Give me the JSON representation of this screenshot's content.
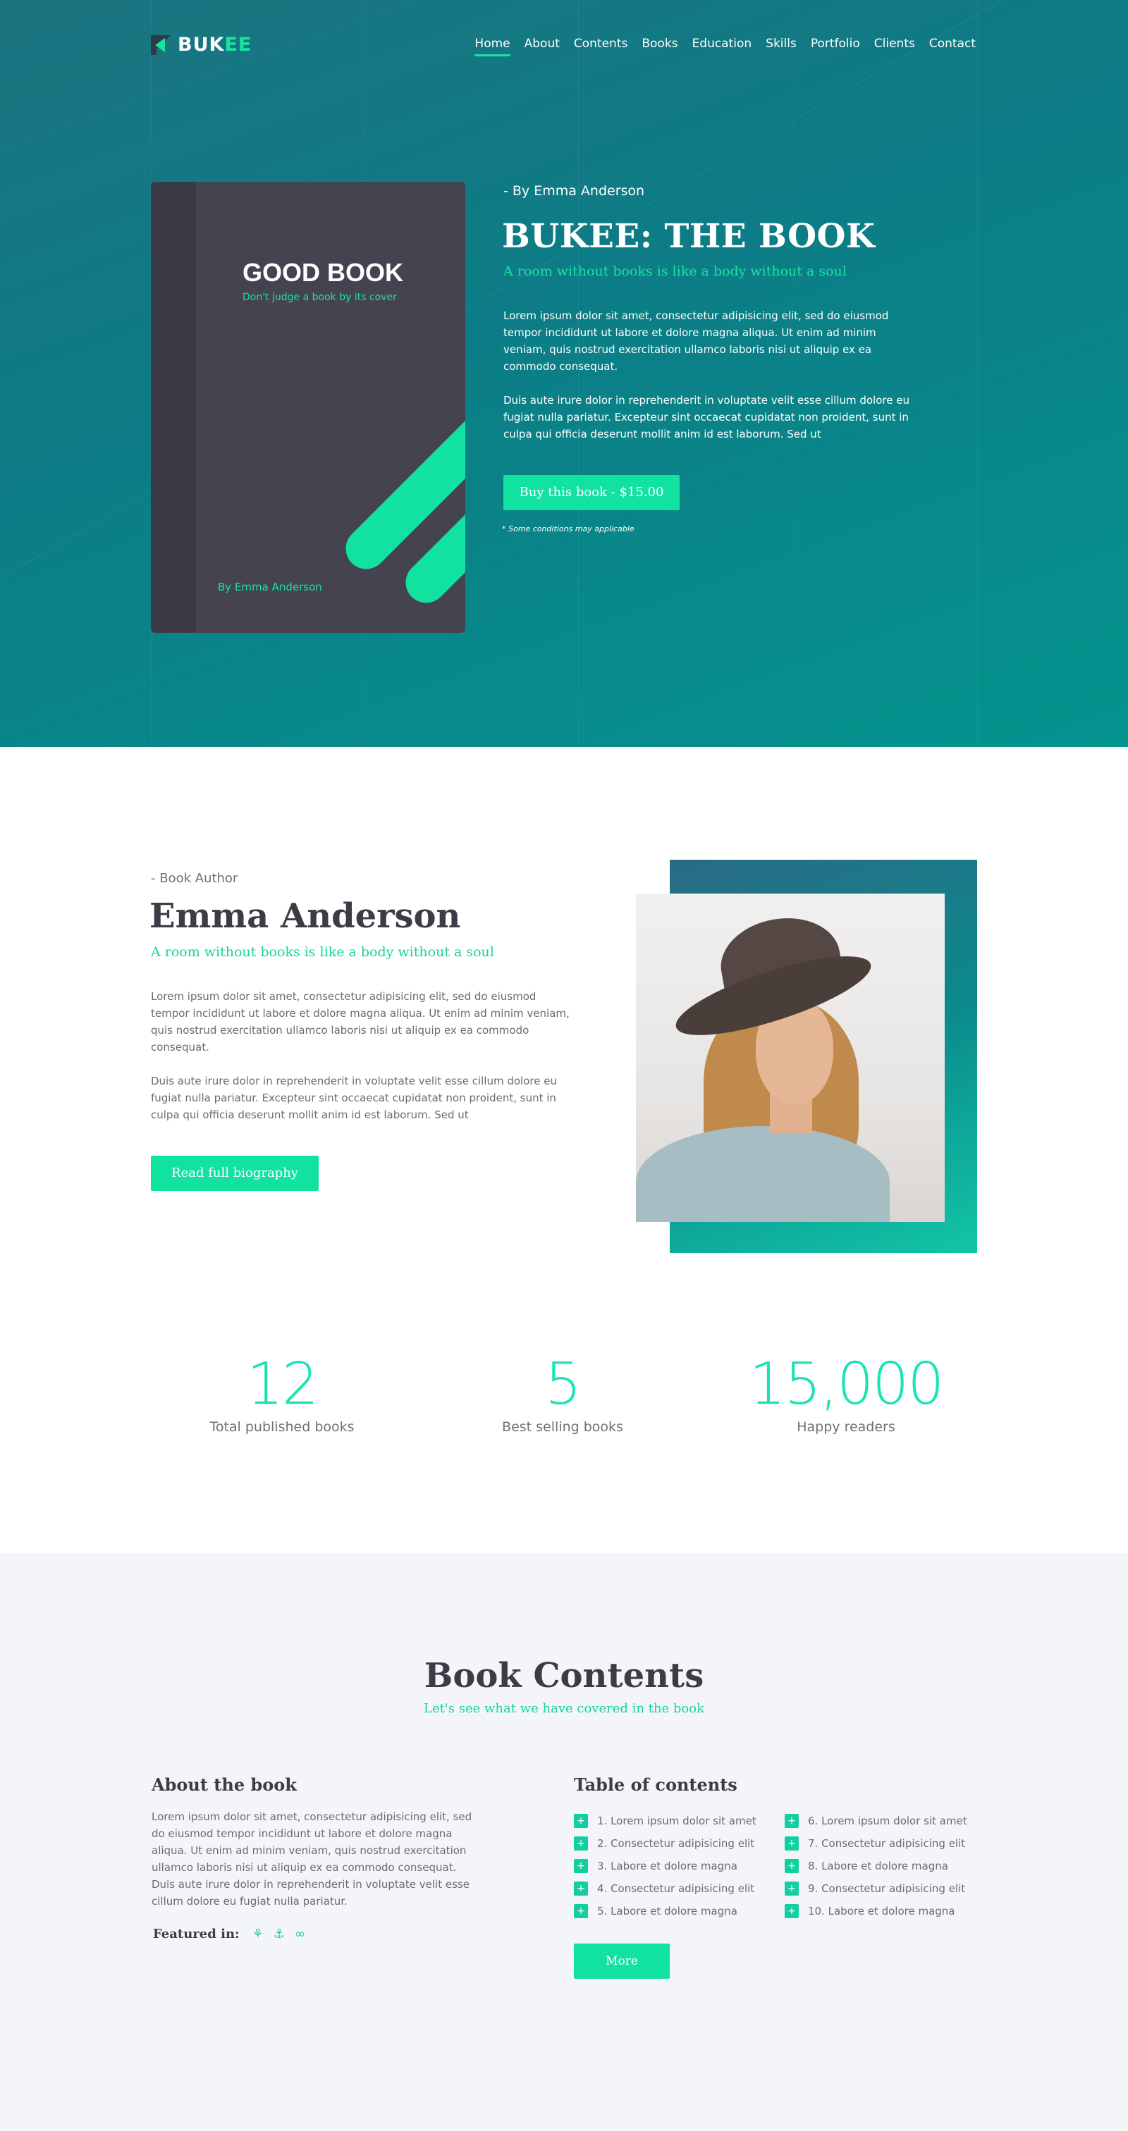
{
  "header": {
    "logo_part1": "BUK",
    "logo_part2": "EE",
    "nav": [
      "Home",
      "About",
      "Contents",
      "Books",
      "Education",
      "Skills",
      "Portfolio",
      "Clients",
      "Contact"
    ],
    "active_nav": "Home"
  },
  "hero": {
    "book_cover": {
      "title": "GOOD BOOK",
      "tagline": "Don't judge a book by its cover",
      "author": "By Emma Anderson"
    },
    "by_line": "- By Emma Anderson",
    "title": "BUKEE: THE BOOK",
    "subtitle": "A room without books is like a body without a soul",
    "paragraph1": "Lorem ipsum dolor sit amet, consectetur adipisicing elit, sed do eiusmod tempor incididunt ut labore et dolore magna aliqua. Ut enim ad minim veniam, quis nostrud exercitation ullamco laboris nisi ut aliquip ex ea commodo consequat.",
    "paragraph2": "Duis aute irure dolor in reprehenderit in voluptate velit esse cillum dolore eu fugiat nulla pariatur. Excepteur sint occaecat cupidatat non proident, sunt in culpa qui officia deserunt mollit anim id est laborum. Sed ut",
    "buy_button": "Buy this book - $15.00",
    "note": "* Some conditions may applicable"
  },
  "author": {
    "label": "- Book Author",
    "name": "Emma Anderson",
    "subtitle": "A room without books is like a body without a soul",
    "paragraph1": "Lorem ipsum dolor sit amet, consectetur adipisicing elit, sed do eiusmod tempor incididunt ut labore et dolore magna aliqua. Ut enim ad minim veniam, quis nostrud exercitation ullamco laboris nisi ut aliquip ex ea commodo consequat.",
    "paragraph2": "Duis aute irure dolor in reprehenderit in voluptate velit esse cillum dolore eu fugiat nulla pariatur. Excepteur sint occaecat cupidatat non proident, sunt in culpa qui officia deserunt mollit anim id est laborum. Sed ut",
    "bio_button": "Read full biography"
  },
  "stats": [
    {
      "value": "12",
      "label": "Total published books"
    },
    {
      "value": "5",
      "label": "Best selling books"
    },
    {
      "value": "15,000",
      "label": "Happy readers"
    }
  ],
  "contents": {
    "title": "Book Contents",
    "subtitle": "Let's see what we have covered in the book",
    "about_heading": "About the book",
    "about_text": "Lorem ipsum dolor sit amet, consectetur adipisicing elit, sed do eiusmod tempor incididunt ut labore et dolore magna aliqua. Ut enim ad minim veniam, quis nostrud exercitation ullamco laboris nisi ut aliquip ex ea commodo consequat. Duis aute irure dolor in reprehenderit in voluptate velit esse cillum dolore eu fugiat nulla pariatur.",
    "featured_label": "Featured in:",
    "featured_icons": [
      "amazon-icon",
      "amazon-alt-icon",
      "goodreads-icon"
    ],
    "toc_heading": "Table of contents",
    "toc_col1": [
      "1. Lorem ipsum dolor sit amet",
      "2. Consectetur adipisicing elit",
      "3. Labore et dolore magna",
      "4. Consectetur adipisicing elit",
      "5. Labore et dolore magna"
    ],
    "toc_col2": [
      "6.  Lorem ipsum dolor sit amet",
      "7. Consectetur adipisicing elit",
      "8. Labore et dolore magna",
      "9. Consectetur adipisicing elit",
      "10. Labore et dolore magna"
    ],
    "toc_bullet": "+",
    "more_button": "More"
  },
  "colors": {
    "accent": "#19e3a0",
    "hero_start": "#1b7480",
    "hero_end": "#04948e",
    "dark_text": "#3c3c46",
    "contents_bg": "#f4f5f9"
  }
}
